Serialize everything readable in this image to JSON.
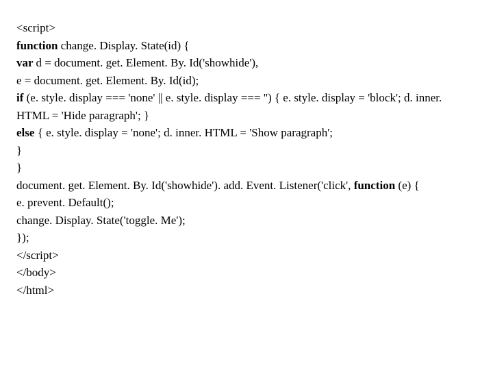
{
  "code": {
    "lines": [
      {
        "segments": [
          {
            "text": "<script>",
            "bold": false
          }
        ]
      },
      {
        "segments": [
          {
            "text": "function ",
            "bold": true
          },
          {
            "text": "change. Display. State(id) {",
            "bold": false
          }
        ]
      },
      {
        "segments": [
          {
            "text": "var ",
            "bold": true
          },
          {
            "text": "d = document. get. Element. By. Id('showhide'),",
            "bold": false
          }
        ]
      },
      {
        "segments": [
          {
            "text": "e = document. get. Element. By. Id(id);",
            "bold": false
          }
        ]
      },
      {
        "segments": [
          {
            "text": "if ",
            "bold": true
          },
          {
            "text": "(e. style. display === 'none' || e. style. display === '') { e. style. display = 'block'; d. inner. HTML = 'Hide paragraph'; }",
            "bold": false
          }
        ]
      },
      {
        "segments": [
          {
            "text": "else ",
            "bold": true
          },
          {
            "text": "{ e. style. display = 'none'; d. inner. HTML = 'Show paragraph';",
            "bold": false
          }
        ]
      },
      {
        "segments": [
          {
            "text": "}",
            "bold": false
          }
        ]
      },
      {
        "segments": [
          {
            "text": "}",
            "bold": false
          }
        ]
      },
      {
        "segments": [
          {
            "text": "document. get. Element. By. Id('showhide'). add. Event. Listener('click', ",
            "bold": false
          },
          {
            "text": "function ",
            "bold": true
          },
          {
            "text": "(e) {",
            "bold": false
          }
        ]
      },
      {
        "segments": [
          {
            "text": "e. prevent. Default();",
            "bold": false
          }
        ]
      },
      {
        "segments": [
          {
            "text": "change. Display. State('toggle. Me');",
            "bold": false
          }
        ]
      },
      {
        "segments": [
          {
            "text": "});",
            "bold": false
          }
        ]
      },
      {
        "segments": [
          {
            "text": "</script>",
            "bold": false
          }
        ]
      },
      {
        "segments": [
          {
            "text": "</body>",
            "bold": false
          }
        ]
      },
      {
        "segments": [
          {
            "text": "</html>",
            "bold": false
          }
        ]
      }
    ]
  }
}
